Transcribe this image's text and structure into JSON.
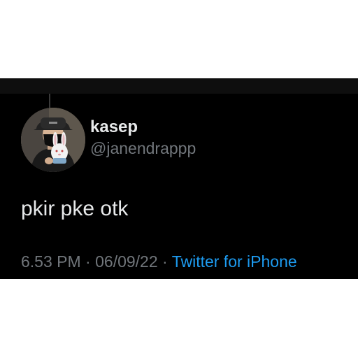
{
  "tweet": {
    "display_name": "kasep",
    "handle": "@janendrappp",
    "text": "pkir pke otk",
    "time": "6.53 PM",
    "separator": "·",
    "date": "06/09/22",
    "source": "Twitter for iPhone"
  },
  "colors": {
    "background": "#000000",
    "primary_text": "#e7e9ea",
    "secondary_text": "#71767b",
    "link": "#1d9bf0"
  },
  "icons": {
    "avatar": "profile-photo-person-with-bunny-plush"
  }
}
